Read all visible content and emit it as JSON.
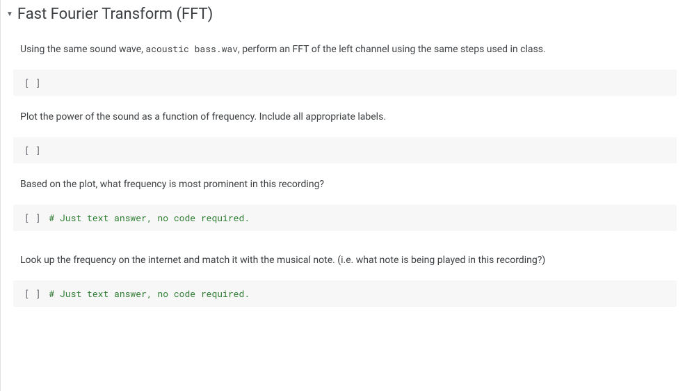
{
  "section": {
    "title": "Fast Fourier Transform (FFT)"
  },
  "cells": [
    {
      "type": "text",
      "before": "Using the same sound wave, ",
      "code_inline": "acoustic bass.wav",
      "after": ", perform an FFT of the left channel using the same steps used in class."
    },
    {
      "type": "code",
      "prompt": "[ ]",
      "content": ""
    },
    {
      "type": "text",
      "before": "Plot the power of the sound as a function of frequency. Include all appropriate labels.",
      "code_inline": "",
      "after": ""
    },
    {
      "type": "code",
      "prompt": "[ ]",
      "content": ""
    },
    {
      "type": "text",
      "before": "Based on the plot, what frequency is most prominent in this recording?",
      "code_inline": "",
      "after": ""
    },
    {
      "type": "code",
      "prompt": "[ ]",
      "content": "# Just text answer, no code required."
    },
    {
      "type": "text",
      "before": "Look up the frequency on the internet and match it with the musical note. (i.e. what note is being played in this recording?)",
      "code_inline": "",
      "after": ""
    },
    {
      "type": "code",
      "prompt": "[ ]",
      "content": "# Just text answer, no code required."
    }
  ]
}
